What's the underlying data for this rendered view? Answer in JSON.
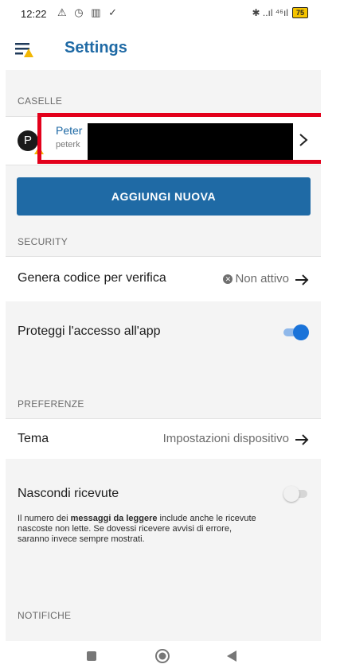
{
  "status_bar": {
    "time": "12:22",
    "left_icons": "⚠ ◷ ▥ ✓",
    "right_icons": "✱ ..ıl ⁴⁶ıl",
    "battery": "75"
  },
  "app_bar": {
    "title": "Settings",
    "menu_icon": "menu-icon",
    "alert_color": "#f2b705"
  },
  "sections": {
    "caselle": "CASELLE",
    "security": "SECURITY",
    "preferenze": "PREFERENZE",
    "notifiche": "NOTIFICHE"
  },
  "account": {
    "avatar_letter": "P",
    "name": "Peter",
    "email": "peterk"
  },
  "add_button": {
    "label": "AGGIUNGI NUOVA"
  },
  "security": {
    "verify_code": {
      "label": "Genera codice per verifica",
      "value": "Non attivo"
    },
    "protect_access": {
      "label": "Proteggi l'accesso all'app",
      "enabled": true
    }
  },
  "preferences": {
    "theme": {
      "label": "Tema",
      "value": "Impostazioni dispositivo"
    },
    "hide_receipts": {
      "label": "Nascondi ricevute",
      "enabled": false,
      "help_pre": "Il numero dei ",
      "help_bold": "messaggi da leggere",
      "help_post": " include anche le ricevute nascoste non lette. Se dovessi ricevere avvisi di errore, saranno invece sempre mostrati."
    }
  },
  "colors": {
    "accent": "#1f6aa5",
    "highlight": "#e3001b",
    "toggle_on": "#1a73d9",
    "toggle_off": "#d6d6d6"
  },
  "nav": [
    "recents-button",
    "home-button",
    "back-button"
  ]
}
